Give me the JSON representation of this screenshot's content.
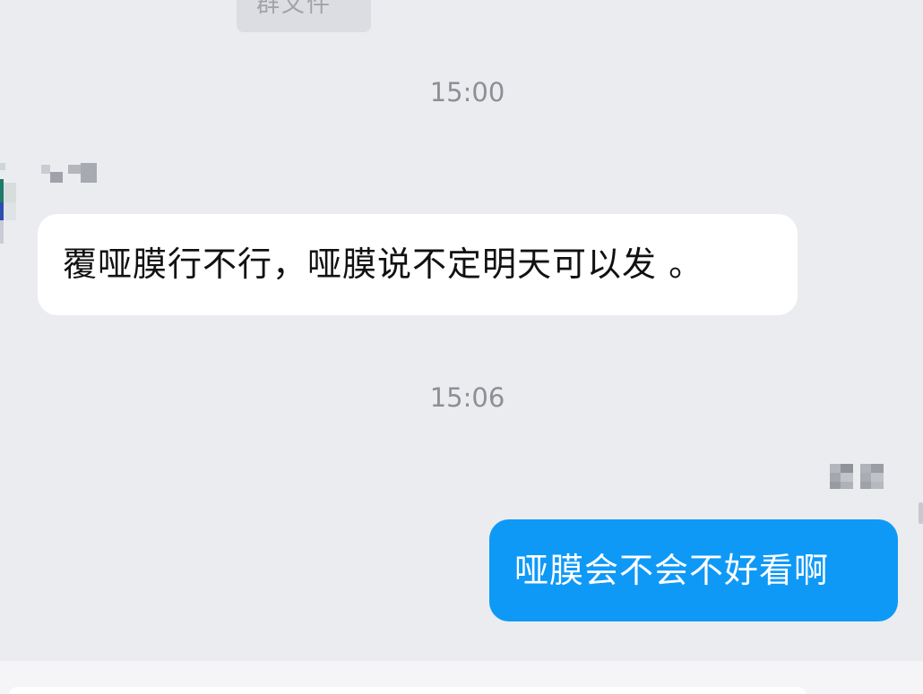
{
  "chat": {
    "file_chip_label": "群文件",
    "timestamps": [
      "15:00",
      "15:06"
    ],
    "messages": [
      {
        "direction": "incoming",
        "text": "覆哑膜行不行，哑膜说不定明天可以发 。"
      },
      {
        "direction": "outgoing",
        "text": "哑膜会不会不好看啊"
      }
    ]
  },
  "colors": {
    "background": "#ebecf0",
    "incoming_bubble": "#ffffff",
    "outgoing_bubble": "#0f99f7",
    "timestamp_text": "#8d8f94"
  }
}
